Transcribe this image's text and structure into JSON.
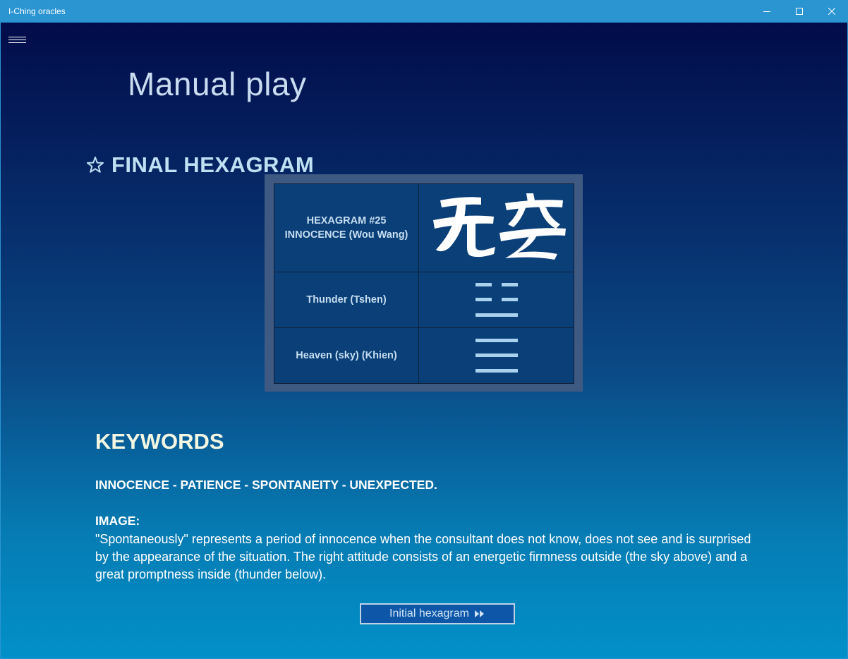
{
  "window": {
    "title": "I-Ching oracles"
  },
  "menu": {
    "icon": "hamburger-menu-icon"
  },
  "page": {
    "title": "Manual play",
    "section_heading": "FINAL HEXAGRAM",
    "section_icon": "star-outline-icon"
  },
  "hexagram": {
    "number_label": "HEXAGRAM #25",
    "name_label": "INNOCENCE (Wou Wang)",
    "character_text": "无妄",
    "upper_trigram": {
      "name": "Thunder (Tshen)",
      "lines_top_to_bottom": [
        "broken",
        "broken",
        "solid"
      ]
    },
    "lower_trigram": {
      "name": "Heaven (sky) (Khien)",
      "lines_top_to_bottom": [
        "solid",
        "solid",
        "solid"
      ]
    }
  },
  "keywords": {
    "heading": "KEYWORDS",
    "line": "INNOCENCE - PATIENCE - SPONTANEITY - UNEXPECTED."
  },
  "image": {
    "label": "IMAGE:",
    "text": "\"Spontaneously\" represents a period of innocence when the consultant does not know, does not see and is surprised by the appearance of the situation. The right attitude consists of an energetic firmness outside (the sky above) and a great promptness inside (thunder below)."
  },
  "navigation": {
    "button_label": "Initial hexagram",
    "button_icon": "double-chevron-right-icon"
  },
  "colors": {
    "titlebar": "#2b95d1",
    "background_top": "#020c4a",
    "background_bottom": "#0290c8",
    "table_frame": "#3e5a82",
    "table_fill": "#0b3f78",
    "accent_text": "#bfe1f3"
  }
}
